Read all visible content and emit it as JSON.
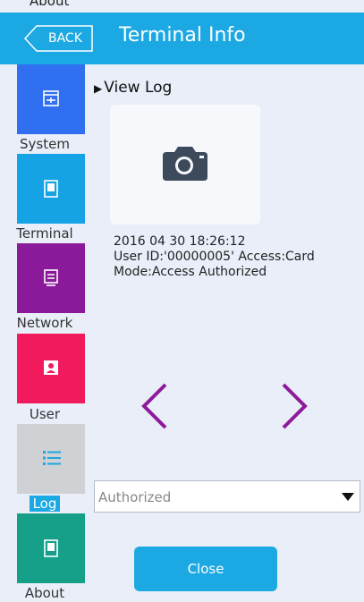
{
  "top_fragment": "About",
  "header": {
    "back_label": "BACK",
    "title": "Terminal Info",
    "color": "#1ca8e2"
  },
  "sidebar": {
    "items": [
      {
        "label": "System",
        "color": "#2f6ff0",
        "icon": "system-icon",
        "selected": false
      },
      {
        "label": "Terminal",
        "color": "#15a3e6",
        "icon": "terminal-icon",
        "selected": false
      },
      {
        "label": "Network",
        "color": "#8a1a9a",
        "icon": "network-icon",
        "selected": false
      },
      {
        "label": "User",
        "color": "#f01a5c",
        "icon": "user-icon",
        "selected": false
      },
      {
        "label": "Log",
        "color": "#cfd1d4",
        "icon": "list-icon",
        "selected": true
      },
      {
        "label": "About",
        "color": "#16a089",
        "icon": "about-icon",
        "selected": false
      }
    ]
  },
  "main": {
    "view_log_label": "View Log",
    "log": {
      "datetime": "2016 04 30 18:26:12",
      "line2": "User ID:'00000005' Access:Card",
      "line3": "Mode:Access Authorized"
    },
    "filter": {
      "selected": "Authorized"
    },
    "close_label": "Close"
  }
}
